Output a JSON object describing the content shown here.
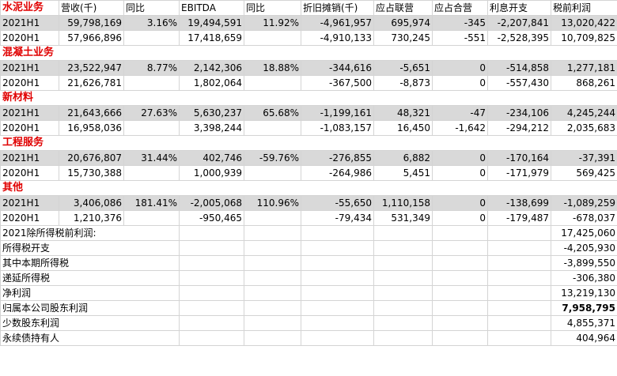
{
  "headers": [
    "",
    "营收(千)",
    "同比",
    "EBITDA",
    "同比",
    "折旧摊销(千)",
    "应占联营",
    "应占合营",
    "利息开支",
    "税前利润"
  ],
  "segments": [
    {
      "name": "水泥业务",
      "rows": [
        [
          "2021H1",
          "59,798,169",
          "3.16%",
          "19,494,591",
          "11.92%",
          "-4,961,957",
          "695,974",
          "-345",
          "-2,207,841",
          "13,020,422"
        ],
        [
          "2020H1",
          "57,966,896",
          "",
          "17,418,659",
          "",
          "-4,910,133",
          "730,245",
          "-551",
          "-2,528,395",
          "10,709,825"
        ]
      ]
    },
    {
      "name": "混凝土业务",
      "rows": [
        [
          "2021H1",
          "23,522,947",
          "8.77%",
          "2,142,306",
          "18.88%",
          "-344,616",
          "-5,651",
          "0",
          "-514,858",
          "1,277,181"
        ],
        [
          "2020H1",
          "21,626,781",
          "",
          "1,802,064",
          "",
          "-367,500",
          "-8,873",
          "0",
          "-557,430",
          "868,261"
        ]
      ]
    },
    {
      "name": "新材料",
      "rows": [
        [
          "2021H1",
          "21,643,666",
          "27.63%",
          "5,630,237",
          "65.68%",
          "-1,199,161",
          "48,321",
          "-47",
          "-234,106",
          "4,245,244"
        ],
        [
          "2020H1",
          "16,958,036",
          "",
          "3,398,244",
          "",
          "-1,083,157",
          "16,450",
          "-1,642",
          "-294,212",
          "2,035,683"
        ]
      ]
    },
    {
      "name": "工程服务",
      "rows": [
        [
          "2021H1",
          "20,676,807",
          "31.44%",
          "402,746",
          "-59.76%",
          "-276,855",
          "6,882",
          "0",
          "-170,164",
          "-37,391"
        ],
        [
          "2020H1",
          "15,730,388",
          "",
          "1,000,939",
          "",
          "-264,986",
          "5,451",
          "0",
          "-171,979",
          "569,425"
        ]
      ]
    },
    {
      "name": "其他",
      "rows": [
        [
          "2021H1",
          "3,406,086",
          "181.41%",
          "-2,005,068",
          "110.96%",
          "-55,650",
          "1,110,158",
          "0",
          "-138,699",
          "-1,089,259"
        ],
        [
          "2020H1",
          "1,210,376",
          "",
          "-950,465",
          "",
          "-79,434",
          "531,349",
          "0",
          "-179,487",
          "-678,037"
        ]
      ]
    }
  ],
  "summary": [
    {
      "label": "2021除所得税前利润:",
      "value": "17,425,060",
      "bold": false
    },
    {
      "label": "所得税开支",
      "value": "-4,205,930",
      "bold": false
    },
    {
      "label": "其中本期所得税",
      "value": "-3,899,550",
      "bold": false
    },
    {
      "label": "递延所得税",
      "value": "-306,380",
      "bold": false
    },
    {
      "label": "净利润",
      "value": "13,219,130",
      "bold": false
    },
    {
      "label": "归属本公司股东利润",
      "value": "7,958,795",
      "bold": true
    },
    {
      "label": "少数股东利润",
      "value": "4,855,371",
      "bold": false
    },
    {
      "label": "永续债持有人",
      "value": "404,964",
      "bold": false
    }
  ],
  "colors": {
    "section_title": "#e00000",
    "shaded_row": "#d9d9d9",
    "grid": "#d4d4d4"
  }
}
